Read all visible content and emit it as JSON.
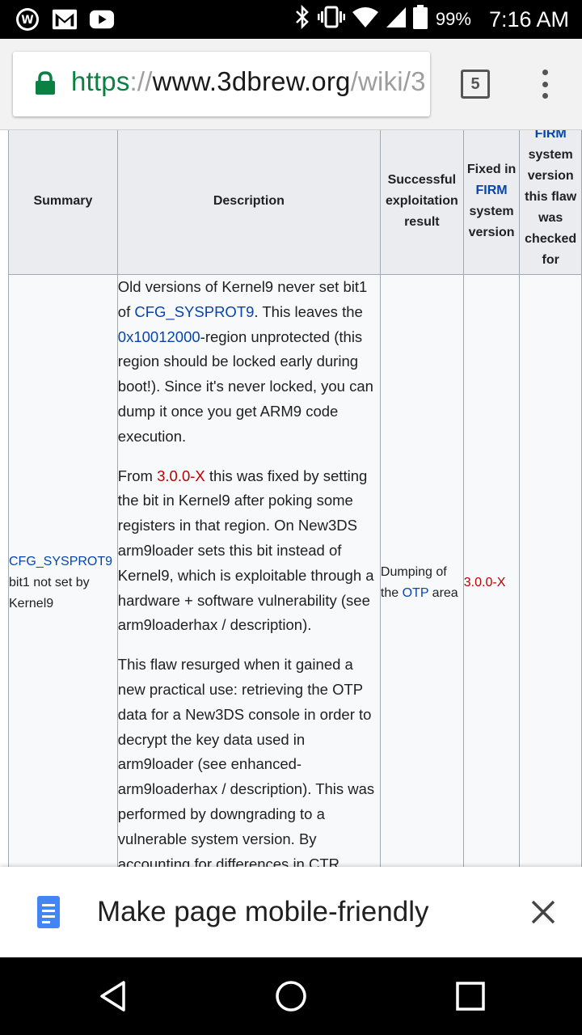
{
  "status_bar": {
    "battery": "99%",
    "time": "7:16 AM"
  },
  "browser": {
    "url_scheme": "https",
    "url_sep": "://",
    "url_host": "www.3dbrew.org",
    "url_path": "/wiki/3",
    "tab_count": "5"
  },
  "table": {
    "headers": {
      "summary": "Summary",
      "description": "Description",
      "result": "Successful exploitation result",
      "fixed_pre": "Fixed in",
      "fixed_link": "FIRM",
      "fixed_post": "system version",
      "checked_link": "FIRM",
      "checked_post": "system version this flaw was checked for"
    },
    "row": {
      "summary_link": "CFG_SYSPROT9",
      "summary_rest": "bit1 not set by Kernel9",
      "desc_p1_a": "Old versions of Kernel9 never set bit1 of ",
      "desc_p1_link1": "CFG_SYSPROT9",
      "desc_p1_b": ". This leaves the ",
      "desc_p1_link2": "0x10012000",
      "desc_p1_c": "-region unprotected (this region should be locked early during boot!). Since it's never locked, you can dump it once you get ARM9 code execution.",
      "desc_p2_a": "From ",
      "desc_p2_link": "3.0.0-X",
      "desc_p2_b": " this was fixed by setting the bit in Kernel9 after poking some registers in that region. On New3DS arm9loader sets this bit instead of Kernel9, which is exploitable through a hardware + software vulnerability (see arm9loaderhax / description).",
      "desc_p3": "This flaw resurged when it gained a new practical use: retrieving the OTP data for a New3DS console in order to decrypt the key data used in arm9loader (see enhanced-arm9loaderhax / description). This was performed by downgrading to a vulnerable system version. By accounting for differences in CTR",
      "result_a": "Dumping of the ",
      "result_link": "OTP",
      "result_b": " area",
      "fixed_in": "3.0.0-X"
    }
  },
  "infobar": {
    "text": "Make page mobile-friendly"
  }
}
